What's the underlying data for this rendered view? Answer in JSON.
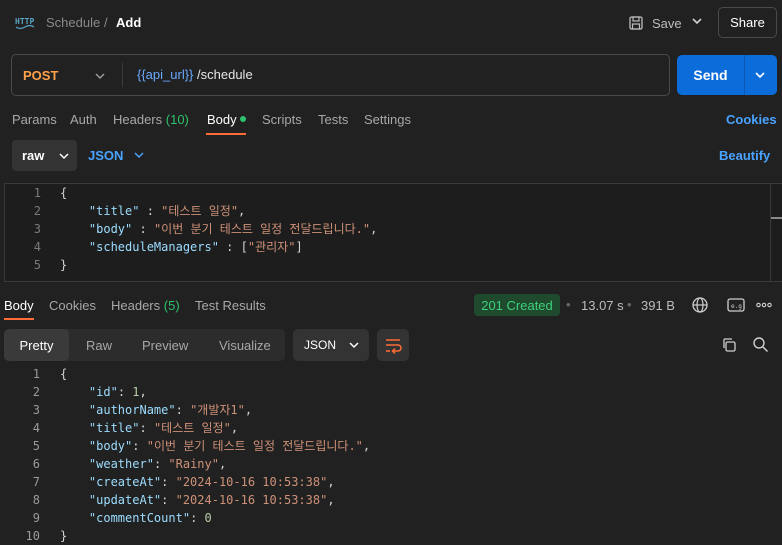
{
  "header": {
    "collection": "Schedule",
    "separator": "/",
    "request_name": "Add",
    "save_label": "Save",
    "share_label": "Share"
  },
  "request": {
    "method": "POST",
    "url_variable": "{{api_url}}",
    "url_path": " /schedule",
    "send_label": "Send"
  },
  "request_tabs": {
    "params": "Params",
    "auth": "Auth",
    "headers": "Headers",
    "headers_count": "(10)",
    "body": "Body",
    "scripts": "Scripts",
    "tests": "Tests",
    "settings": "Settings",
    "cookies": "Cookies"
  },
  "body_options": {
    "mode": "raw",
    "language": "JSON",
    "beautify": "Beautify"
  },
  "request_body_lines": [
    {
      "n": "1",
      "parts": [
        [
          "p",
          "{"
        ]
      ]
    },
    {
      "n": "2",
      "parts": [
        [
          "p",
          "    "
        ],
        [
          "k",
          "\"title\""
        ],
        [
          "p",
          " : "
        ],
        [
          "s",
          "\"테스트 일정\""
        ],
        [
          "p",
          ","
        ]
      ]
    },
    {
      "n": "3",
      "parts": [
        [
          "p",
          "    "
        ],
        [
          "k",
          "\"body\""
        ],
        [
          "p",
          " : "
        ],
        [
          "s",
          "\"이번 분기 테스트 일정 전달드립니다.\""
        ],
        [
          "p",
          ","
        ]
      ]
    },
    {
      "n": "4",
      "parts": [
        [
          "p",
          "    "
        ],
        [
          "k",
          "\"scheduleManagers\""
        ],
        [
          "p",
          " : ["
        ],
        [
          "s",
          "\"관리자\""
        ],
        [
          "p",
          "]"
        ]
      ]
    },
    {
      "n": "5",
      "parts": [
        [
          "p",
          "}"
        ]
      ]
    }
  ],
  "response_tabs": {
    "body": "Body",
    "cookies": "Cookies",
    "headers": "Headers",
    "headers_count": "(5)",
    "test_results": "Test Results"
  },
  "response_meta": {
    "status": "201 Created",
    "time": "13.07 s",
    "size": "391 B",
    "dot": "•"
  },
  "response_formats": {
    "pretty": "Pretty",
    "raw": "Raw",
    "preview": "Preview",
    "visualize": "Visualize",
    "language": "JSON"
  },
  "response_body_lines": [
    {
      "n": "1",
      "parts": [
        [
          "p",
          "{"
        ]
      ]
    },
    {
      "n": "2",
      "parts": [
        [
          "p",
          "    "
        ],
        [
          "k",
          "\"id\""
        ],
        [
          "p",
          ": "
        ],
        [
          "n",
          "1"
        ],
        [
          "p",
          ","
        ]
      ]
    },
    {
      "n": "3",
      "parts": [
        [
          "p",
          "    "
        ],
        [
          "k",
          "\"authorName\""
        ],
        [
          "p",
          ": "
        ],
        [
          "s",
          "\"개발자1\""
        ],
        [
          "p",
          ","
        ]
      ]
    },
    {
      "n": "4",
      "parts": [
        [
          "p",
          "    "
        ],
        [
          "k",
          "\"title\""
        ],
        [
          "p",
          ": "
        ],
        [
          "s",
          "\"테스트 일정\""
        ],
        [
          "p",
          ","
        ]
      ]
    },
    {
      "n": "5",
      "parts": [
        [
          "p",
          "    "
        ],
        [
          "k",
          "\"body\""
        ],
        [
          "p",
          ": "
        ],
        [
          "s",
          "\"이번 분기 테스트 일정 전달드립니다.\""
        ],
        [
          "p",
          ","
        ]
      ]
    },
    {
      "n": "6",
      "parts": [
        [
          "p",
          "    "
        ],
        [
          "k",
          "\"weather\""
        ],
        [
          "p",
          ": "
        ],
        [
          "s",
          "\"Rainy\""
        ],
        [
          "p",
          ","
        ]
      ]
    },
    {
      "n": "7",
      "parts": [
        [
          "p",
          "    "
        ],
        [
          "k",
          "\"createAt\""
        ],
        [
          "p",
          ": "
        ],
        [
          "s",
          "\"2024-10-16 10:53:38\""
        ],
        [
          "p",
          ","
        ]
      ]
    },
    {
      "n": "8",
      "parts": [
        [
          "p",
          "    "
        ],
        [
          "k",
          "\"updateAt\""
        ],
        [
          "p",
          ": "
        ],
        [
          "s",
          "\"2024-10-16 10:53:38\""
        ],
        [
          "p",
          ","
        ]
      ]
    },
    {
      "n": "9",
      "parts": [
        [
          "p",
          "    "
        ],
        [
          "k",
          "\"commentCount\""
        ],
        [
          "p",
          ": "
        ],
        [
          "n",
          "0"
        ]
      ]
    },
    {
      "n": "10",
      "parts": [
        [
          "p",
          "}"
        ]
      ]
    }
  ],
  "colors": {
    "accent_orange": "#ff6c37",
    "send_blue": "#0b6cda",
    "link_blue": "#4aa3ff",
    "status_green": "#3ed07a",
    "method_orange": "#ffa24b"
  },
  "icons": [
    "http-icon",
    "save-icon",
    "chevron-down-icon",
    "globe-icon",
    "example-icon",
    "more-icon",
    "wrap-lines-icon",
    "copy-icon",
    "search-icon"
  ]
}
